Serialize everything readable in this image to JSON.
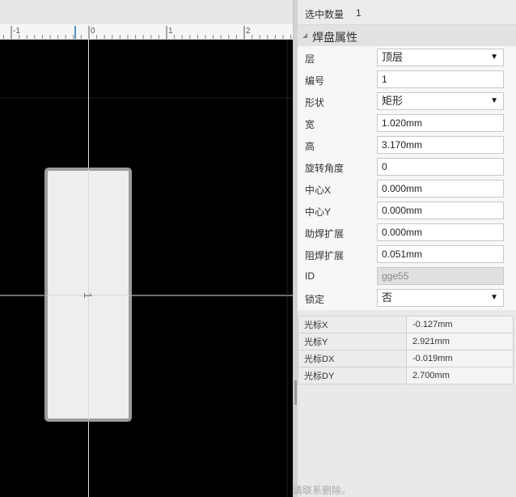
{
  "ruler": {
    "ticks": [
      "-1",
      "0",
      "1",
      "2"
    ]
  },
  "canvas": {
    "pad_number": "1",
    "colors": {
      "background": "#000000",
      "pad": "#eeeeee",
      "pad_border": "#9c9c9c",
      "crosshair": "#dddddd"
    }
  },
  "selection": {
    "label": "选中数量",
    "value": "1"
  },
  "section": {
    "title": "焊盘属性"
  },
  "properties": [
    {
      "label": "层",
      "value": "顶层",
      "type": "select"
    },
    {
      "label": "编号",
      "value": "1",
      "type": "input"
    },
    {
      "label": "形状",
      "value": "矩形",
      "type": "select"
    },
    {
      "label": "宽",
      "value": "1.020mm",
      "type": "input"
    },
    {
      "label": "高",
      "value": "3.170mm",
      "type": "input"
    },
    {
      "label": "旋转角度",
      "value": "0",
      "type": "input"
    },
    {
      "label": "中心X",
      "value": "0.000mm",
      "type": "input"
    },
    {
      "label": "中心Y",
      "value": "0.000mm",
      "type": "input"
    },
    {
      "label": "助焊扩展",
      "value": "0.000mm",
      "type": "input"
    },
    {
      "label": "阻焊扩展",
      "value": "0.051mm",
      "type": "input"
    },
    {
      "label": "ID",
      "value": "gge55",
      "type": "disabled"
    },
    {
      "label": "锁定",
      "value": "否",
      "type": "select"
    }
  ],
  "cursor": [
    {
      "label": "光标X",
      "value": "-0.127mm"
    },
    {
      "label": "光标Y",
      "value": "2.921mm"
    },
    {
      "label": "光标DX",
      "value": "-0.019mm"
    },
    {
      "label": "光标DY",
      "value": "2.700mm"
    }
  ],
  "bottom_note": "请联系删除。",
  "icons": {
    "dropdown": "chevron-down-icon",
    "collapse": "triangle-down-icon"
  }
}
